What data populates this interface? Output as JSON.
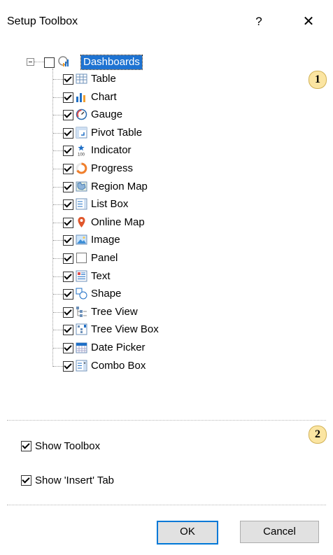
{
  "window": {
    "title": "Setup Toolbox",
    "help_label": "?",
    "close_label": "✕"
  },
  "tree": {
    "root": {
      "label": "Dashboards",
      "checked": false,
      "icon": "dashboard-icon"
    },
    "items": [
      {
        "label": "Table",
        "checked": true,
        "icon": "table-icon"
      },
      {
        "label": "Chart",
        "checked": true,
        "icon": "chart-icon"
      },
      {
        "label": "Gauge",
        "checked": true,
        "icon": "gauge-icon"
      },
      {
        "label": "Pivot Table",
        "checked": true,
        "icon": "pivot-table-icon"
      },
      {
        "label": "Indicator",
        "checked": true,
        "icon": "indicator-icon"
      },
      {
        "label": "Progress",
        "checked": true,
        "icon": "progress-icon"
      },
      {
        "label": "Region Map",
        "checked": true,
        "icon": "region-map-icon"
      },
      {
        "label": "List Box",
        "checked": true,
        "icon": "list-box-icon"
      },
      {
        "label": "Online Map",
        "checked": true,
        "icon": "online-map-icon"
      },
      {
        "label": "Image",
        "checked": true,
        "icon": "image-icon"
      },
      {
        "label": "Panel",
        "checked": true,
        "icon": "panel-icon"
      },
      {
        "label": "Text",
        "checked": true,
        "icon": "text-icon"
      },
      {
        "label": "Shape",
        "checked": true,
        "icon": "shape-icon"
      },
      {
        "label": "Tree View",
        "checked": true,
        "icon": "tree-view-icon"
      },
      {
        "label": "Tree View Box",
        "checked": true,
        "icon": "tree-view-box-icon"
      },
      {
        "label": "Date Picker",
        "checked": true,
        "icon": "date-picker-icon"
      },
      {
        "label": "Combo Box",
        "checked": true,
        "icon": "combo-box-icon"
      }
    ]
  },
  "badges": {
    "one": "1",
    "two": "2"
  },
  "options": {
    "show_toolbox": {
      "label": "Show Toolbox",
      "checked": true
    },
    "show_insert_tab": {
      "label": "Show 'Insert' Tab",
      "checked": true
    }
  },
  "buttons": {
    "ok": "OK",
    "cancel": "Cancel"
  },
  "colors": {
    "selection": "#1e73d2",
    "badge_fill": "#fbe5a2",
    "default_button_border": "#0078d7"
  }
}
